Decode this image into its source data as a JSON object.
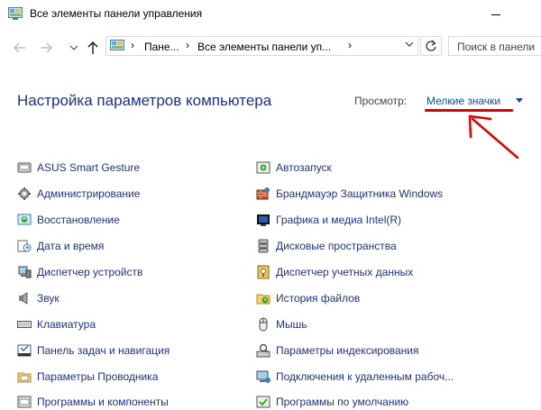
{
  "window": {
    "title": "Все элементы панели управления"
  },
  "navigation": {
    "breadcrumbs": [
      "Пане...",
      "Все элементы панели уп..."
    ],
    "search_placeholder": "Поиск в панели"
  },
  "header": {
    "title": "Настройка параметров компьютера",
    "view_label": "Просмотр:",
    "view_value": "Мелкие значки"
  },
  "colors": {
    "link": "#1e3287",
    "accent": "#0b4dab",
    "annotation": "#e00000"
  },
  "items_left": [
    {
      "label": "ASUS Smart Gesture",
      "icon": "touchpad-icon"
    },
    {
      "label": "Администрирование",
      "icon": "admin-tools-icon"
    },
    {
      "label": "Восстановление",
      "icon": "recovery-icon"
    },
    {
      "label": "Дата и время",
      "icon": "clock-icon"
    },
    {
      "label": "Диспетчер устройств",
      "icon": "device-manager-icon"
    },
    {
      "label": "Звук",
      "icon": "speaker-icon"
    },
    {
      "label": "Клавиатура",
      "icon": "keyboard-icon"
    },
    {
      "label": "Панель задач и навигация",
      "icon": "taskbar-icon"
    },
    {
      "label": "Параметры Проводника",
      "icon": "folder-options-icon"
    },
    {
      "label": "Программы и компоненты",
      "icon": "programs-icon"
    }
  ],
  "items_right": [
    {
      "label": "Автозапуск",
      "icon": "autoplay-icon"
    },
    {
      "label": "Брандмауэр Защитника Windows",
      "icon": "firewall-icon"
    },
    {
      "label": "Графика и медиа Intel(R)",
      "icon": "intel-graphics-icon"
    },
    {
      "label": "Дисковые пространства",
      "icon": "storage-spaces-icon"
    },
    {
      "label": "Диспетчер учетных данных",
      "icon": "credential-manager-icon"
    },
    {
      "label": "История файлов",
      "icon": "file-history-icon"
    },
    {
      "label": "Мышь",
      "icon": "mouse-icon"
    },
    {
      "label": "Параметры индексирования",
      "icon": "indexing-icon"
    },
    {
      "label": "Подключения к удаленным рабоч...",
      "icon": "remote-desktop-icon"
    },
    {
      "label": "Программы по умолчанию",
      "icon": "default-programs-icon"
    }
  ]
}
